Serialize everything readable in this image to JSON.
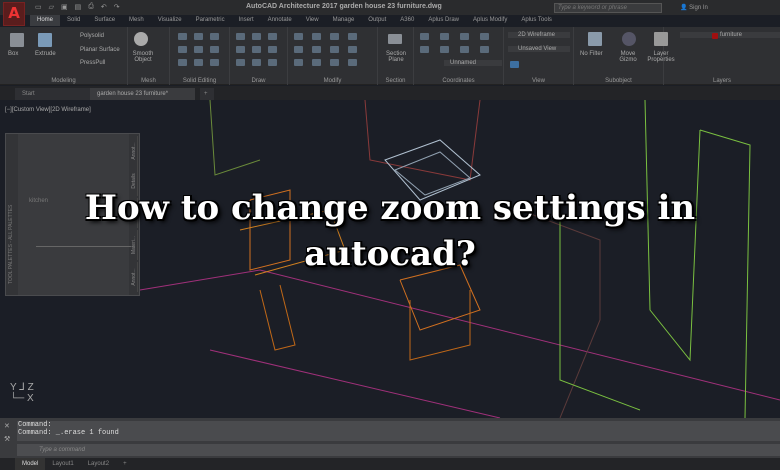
{
  "app": {
    "logo": "A",
    "title": "AutoCAD Architecture 2017   garden house 23 furniture.dwg",
    "search_placeholder": "Type a keyword or phrase",
    "sign_in": "Sign In"
  },
  "ribbon_tabs": [
    "Home",
    "Solid",
    "Surface",
    "Mesh",
    "Visualize",
    "Parametric",
    "Insert",
    "Annotate",
    "View",
    "Manage",
    "Output",
    "A360",
    "Aplus Draw",
    "Aplus Modify",
    "Aplus Tools"
  ],
  "panels": {
    "modeling": {
      "label": "Modeling",
      "box": "Box",
      "extrude": "Extrude",
      "polysolid": "Polysolid",
      "planar": "Planar Surface",
      "presspull": "PressPull"
    },
    "mesh": {
      "label": "Mesh",
      "smooth": "Smooth Object"
    },
    "solid_editing": {
      "label": "Solid Editing"
    },
    "draw": {
      "label": "Draw"
    },
    "modify": {
      "label": "Modify"
    },
    "section": {
      "label": "Section",
      "plane": "Section Plane"
    },
    "coordinates": {
      "label": "Coordinates",
      "ucs": "Unnamed"
    },
    "view": {
      "label": "View",
      "visual_style": "2D Wireframe",
      "named_view": "Unsaved View"
    },
    "subobject": {
      "label": "Subobject",
      "filter": "No Filter",
      "gizmo": "Move Gizmo"
    },
    "layers": {
      "label": "Layers",
      "properties": "Layer Properties",
      "current": "furniture"
    }
  },
  "doc_tabs": [
    "Start",
    "garden house 23 furniture*",
    "+"
  ],
  "viewport": {
    "label": "[−][Custom View][2D Wireframe]",
    "palette_title": "TOOL PALETTES - ALL PALETTES",
    "palette_section": "kitchen",
    "palette_tabs": [
      "Annot...",
      "Details",
      "Design",
      "Materi...",
      "Annot..."
    ]
  },
  "overlay": {
    "line1": "How to change zoom settings in",
    "line2": "autocad?"
  },
  "command": {
    "history": [
      "Command:",
      "Command:  _.erase 1 found"
    ],
    "placeholder": "Type a command"
  },
  "layout_tabs": [
    "Model",
    "Layout1",
    "Layout2",
    "+"
  ]
}
